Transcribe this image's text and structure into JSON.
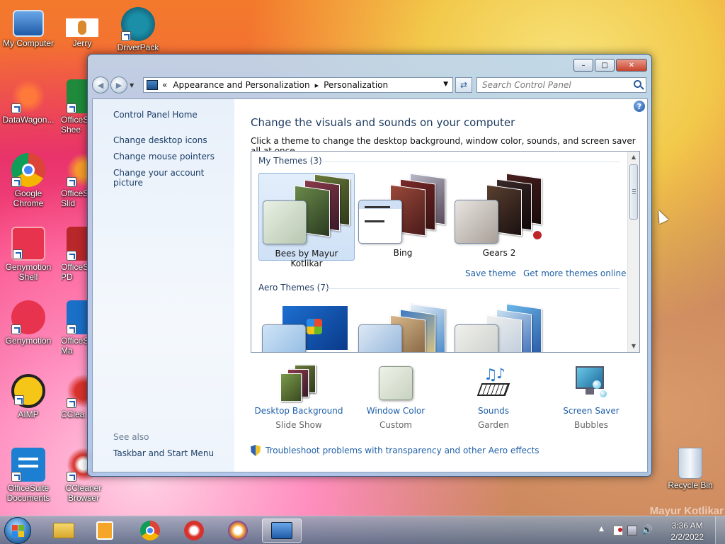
{
  "desktop": {
    "icons": [
      {
        "label": "My Computer",
        "icon": "computer-icon"
      },
      {
        "label": "Jerry",
        "icon": "jerry-icon"
      },
      {
        "label": "DriverPack",
        "icon": "driverpack-icon"
      },
      {
        "label": "DataWagon...",
        "icon": "datawagon-icon"
      },
      {
        "label": "OfficeS Shee",
        "icon": "officesuite-sheets-icon"
      },
      {
        "label": "Google Chrome",
        "icon": "chrome-icon"
      },
      {
        "label": "OfficeS Slid",
        "icon": "officesuite-slides-icon"
      },
      {
        "label": "Genymotion Shell",
        "icon": "genymotion-shell-icon"
      },
      {
        "label": "OfficeS PD",
        "icon": "officesuite-pdf-icon"
      },
      {
        "label": "Genymotion",
        "icon": "genymotion-icon"
      },
      {
        "label": "OfficeS Ma",
        "icon": "officesuite-mail-icon"
      },
      {
        "label": "AIMP",
        "icon": "aimp-icon"
      },
      {
        "label": "CClea",
        "icon": "ccleaner-icon"
      },
      {
        "label": "OfficeSuite Documents",
        "icon": "officesuite-documents-icon"
      },
      {
        "label": "CCleaner Browser",
        "icon": "ccleaner-browser-icon"
      },
      {
        "label": "Recycle Bin",
        "icon": "recycle-bin-icon"
      }
    ],
    "watermark": "Mayur Kotlikar"
  },
  "window": {
    "controls": {
      "minimize": "–",
      "maximize": "□",
      "close": "✕"
    },
    "breadcrumb": {
      "prefix": "«",
      "items": [
        "Appearance and Personalization",
        "Personalization"
      ],
      "separator": "▸"
    },
    "search_placeholder": "Search Control Panel",
    "sidebar": {
      "home": "Control Panel Home",
      "links": [
        "Change desktop icons",
        "Change mouse pointers",
        "Change your account picture"
      ],
      "see_also_label": "See also",
      "see_also_links": [
        "Taskbar and Start Menu"
      ]
    },
    "main": {
      "help": "?",
      "title": "Change the visuals and sounds on your computer",
      "subtitle": "Click a theme to change the desktop background, window color, sounds, and screen saver all at once.",
      "my_themes_label": "My Themes (3)",
      "my_themes": [
        {
          "name": "Bees by Mayur Kotlikar",
          "selected": true
        },
        {
          "name": "Bing",
          "selected": false
        },
        {
          "name": "Gears 2",
          "selected": false
        }
      ],
      "save_theme": "Save theme",
      "get_more": "Get more themes online",
      "aero_themes_label": "Aero Themes (7)",
      "options": [
        {
          "title": "Desktop Background",
          "sub": "Slide Show",
          "icon": "desktop-background-icon"
        },
        {
          "title": "Window Color",
          "sub": "Custom",
          "icon": "window-color-icon"
        },
        {
          "title": "Sounds",
          "sub": "Garden",
          "icon": "sounds-icon"
        },
        {
          "title": "Screen Saver",
          "sub": "Bubbles",
          "icon": "screen-saver-icon"
        }
      ],
      "troubleshoot": "Troubleshoot problems with transparency and other Aero effects"
    }
  },
  "taskbar": {
    "items": [
      "explorer-icon",
      "media-player-icon",
      "chrome-icon",
      "ccleaner-icon",
      "avast-browser-icon",
      "control-panel-icon"
    ],
    "clock": {
      "time": "3:36 AM",
      "date": "2/2/2022"
    },
    "tray_arrow": "▲"
  }
}
